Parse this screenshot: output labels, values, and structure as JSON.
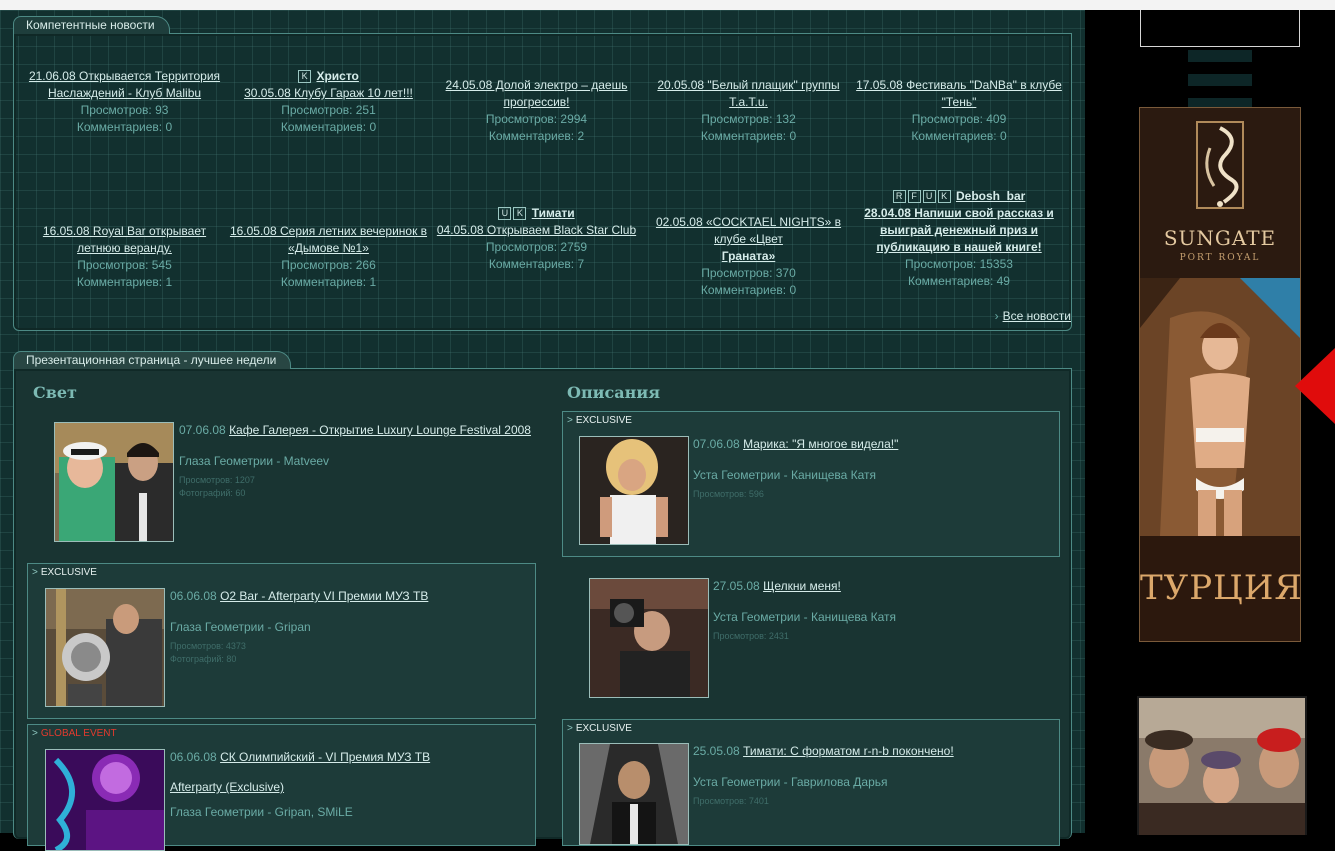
{
  "news": {
    "title": "Компетентные новости",
    "items": [
      {
        "link": "21.06.08 Открывается Территория Наслаждений - Клуб Malibu",
        "views": "Просмотров: 93",
        "comments": "Комментариев: 0"
      },
      {
        "flags": [
          "K"
        ],
        "tag": "Христо",
        "link": "30.05.08 Клубу Гараж 10 лет!!!",
        "views": "Просмотров: 251",
        "comments": "Комментариев: 0"
      },
      {
        "link": "24.05.08 Долой электро – даешь прогрессив!",
        "views": "Просмотров: 2994",
        "comments": "Комментариев: 2"
      },
      {
        "link": "20.05.08 \"Белый плащик\" группы T.a.T.u.",
        "views": "Просмотров: 132",
        "comments": "Комментариев: 0"
      },
      {
        "link": "17.05.08 Фестиваль \"DaNBa\" в клубе \"Тень\"",
        "views": "Просмотров: 409",
        "comments": "Комментариев: 0"
      },
      {
        "link": "16.05.08 Royal Bar открывает летнюю веранду.",
        "views": "Просмотров: 545",
        "comments": "Комментариев: 1"
      },
      {
        "link": "16.05.08 Серия летних вечеринок в «Дымове №1»",
        "views": "Просмотров: 266",
        "comments": "Комментариев: 1"
      },
      {
        "flags": [
          "U",
          "K"
        ],
        "tag": "Тимати",
        "link": "04.05.08 Открываем Black Star Club",
        "views": "Просмотров: 2759",
        "comments": "Комментариев: 7"
      },
      {
        "link_plain": "02.05.08 «COCKTAEL NIGHTS» в клубе «Цвет",
        "link": "Граната»",
        "views": "Просмотров: 370",
        "comments": "Комментариев: 0"
      },
      {
        "flags": [
          "R",
          "F",
          "U",
          "K"
        ],
        "tag": "Debosh_bar",
        "link": "28.04.08 Напиши свой рассказ и выиграй денежный приз и публикацию в нашей книге!",
        "views": "Просмотров: 15353",
        "comments": "Комментариев: 49"
      }
    ],
    "all_news": "Все новости",
    "arrow": "›"
  },
  "presentation": {
    "title": "Презентационная страница - лучшее недели",
    "left_title": "Свет",
    "right_title": "Описания",
    "left": [
      {
        "date": "07.06.08",
        "link": "Кафе Галерея - Открытие Luxury Lounge Festival 2008",
        "source": "Глаза Геометрии - Matveev",
        "views": "Просмотров: 1207",
        "photos": "Фотографий: 60"
      },
      {
        "label": "EXCLUSIVE",
        "date": "06.06.08",
        "link": "O2 Bar - Afterparty VI Премии МУЗ ТВ",
        "source": "Глаза Геометрии - Gripan",
        "views": "Просмотров: 4373",
        "photos": "Фотографий: 80"
      },
      {
        "label": "GLOBAL EVENT",
        "date": "06.06.08",
        "link": "СК Олимпийский - VI Премия МУЗ ТВ",
        "link2": "Afterparty (Exclusive)",
        "source": "Глаза Геометрии - Gripan, SMiLE"
      }
    ],
    "right": [
      {
        "label": "EXCLUSIVE",
        "date": "07.06.08",
        "link": "Марика: \"Я многое видела!\"",
        "source": "Уста Геометрии - Канищева Катя",
        "views": "Просмотров: 596"
      },
      {
        "date": "27.05.08",
        "link": "Щелкни меня!",
        "source": "Уста Геометрии - Канищева Катя",
        "views": "Просмотров: 2431"
      },
      {
        "label": "EXCLUSIVE",
        "date": "25.05.08",
        "link": "Тимати: С форматом r-n-b покончено!",
        "source": "Уста Геометрии - Гаврилова Дарья",
        "views": "Просмотров: 7401"
      }
    ],
    "marker": ">"
  },
  "sidebar": {
    "ad_brand": "SUNGATE",
    "ad_sub": "PORT ROYAL",
    "ad_country": "ТУРЦИЯ"
  },
  "colors": {
    "accent_red": "#e00c0c",
    "link": "#d6ecea",
    "muted": "#6aaba5",
    "global_event": "#e33a2e"
  }
}
